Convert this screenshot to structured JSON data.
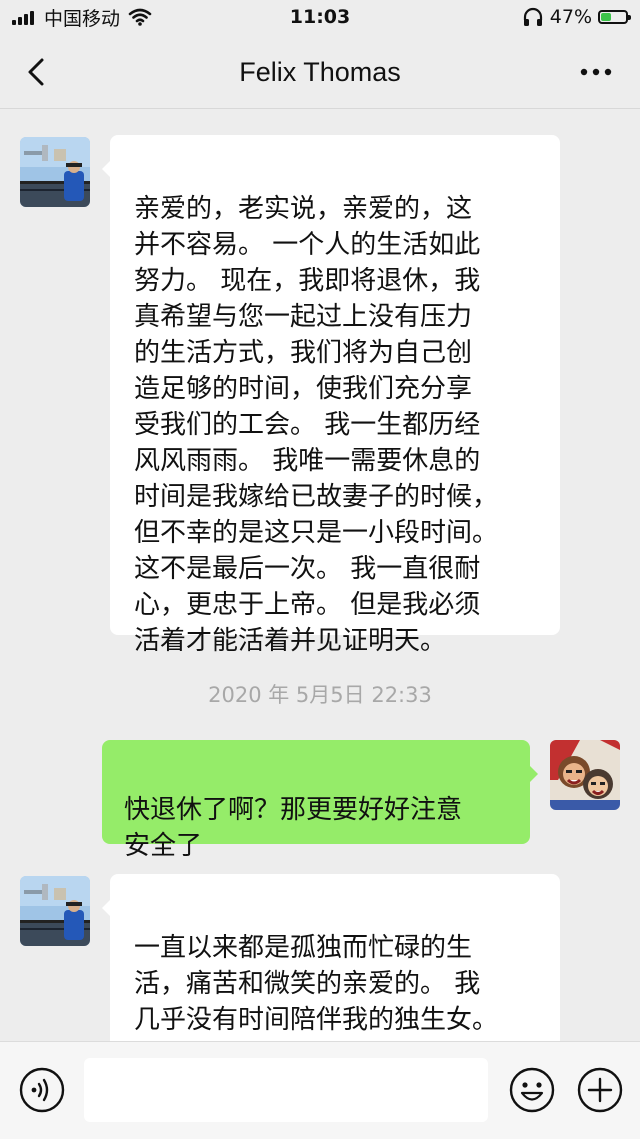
{
  "status_bar": {
    "carrier": "中国移动",
    "time": "11:03",
    "battery_percent": "47%",
    "battery_level": 0.47
  },
  "nav": {
    "title": "Felix Thomas"
  },
  "messages": [
    {
      "from": "contact",
      "text": "亲爱的，老实说，亲爱的，这\n并不容易。 一个人的生活如此\n努力。 现在，我即将退休，我\n真希望与您一起过上没有压力\n的生活方式，我们将为自己创\n造足够的时间，使我们充分享\n受我们的工会。 我一生都历经\n风风雨雨。 我唯一需要休息的\n时间是我嫁给已故妻子的时候，\n但不幸的是这只是一小段时间。\n 这不是最后一次。 我一直很耐\n心，更忠于上帝。 但是我必须\n活着才能活着并见证明天。"
    },
    {
      "from": "system",
      "text": "2020 年 5月5日 22:33"
    },
    {
      "from": "me",
      "text": "快退休了啊？那更要好好注意\n安全了"
    },
    {
      "from": "contact",
      "text": "一直以来都是孤独而忙碌的生\n活，痛苦和微笑的亲爱的。 我\n几乎没有时间陪伴我的独生女。\n 政府向银行支付的薪金和津贴\n手机上都是海文，一切都很稳固"
    }
  ],
  "input": {
    "value": "",
    "placeholder": ""
  },
  "colors": {
    "background": "#ededed",
    "bubble_incoming": "#ffffff",
    "bubble_outgoing": "#95ec69",
    "timestamp_text": "#a8a8a8",
    "battery_fill": "#3cc24a"
  },
  "icons": {
    "back": "chevron-left-icon",
    "more": "more-dots-icon",
    "voice": "voice-icon",
    "emoji": "emoji-icon",
    "add": "plus-circle-icon",
    "wifi": "wifi-icon",
    "headphones": "headphones-icon",
    "signal": "signal-icon",
    "battery": "battery-icon"
  }
}
